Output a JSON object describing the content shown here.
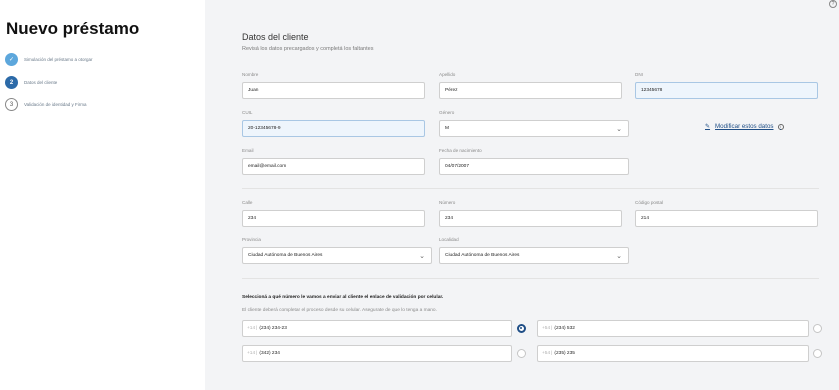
{
  "sidebar": {
    "title": "Nuevo préstamo",
    "steps": [
      {
        "label": "Simulación del préstamo a otorgar",
        "status": "done",
        "marker": "✓"
      },
      {
        "label": "Datos del cliente",
        "status": "active",
        "marker": "2"
      },
      {
        "label": "Validación de identidad y Firma",
        "status": "pending",
        "marker": "3"
      }
    ]
  },
  "form": {
    "title": "Datos del cliente",
    "subtitle": "Revisá los datos precargados y completá los faltantes",
    "fields": {
      "nombre": {
        "label": "Nombre",
        "value": "Juan"
      },
      "apellido": {
        "label": "Apellido",
        "value": "Pérez"
      },
      "dni": {
        "label": "DNI",
        "value": "12345678"
      },
      "cuil": {
        "label": "CUIL",
        "value": "20-12345678-9"
      },
      "genero": {
        "label": "Género",
        "value": "M"
      },
      "email": {
        "label": "Email",
        "value": "email@email.com"
      },
      "fecha": {
        "label": "Fecha de nacimiento",
        "value": "04/07/2007"
      },
      "calle": {
        "label": "Calle",
        "value": "234"
      },
      "numero": {
        "label": "Número",
        "value": "234"
      },
      "cp": {
        "label": "Código postal",
        "value": "214"
      },
      "provincia": {
        "label": "Provincia",
        "value": "Ciudad Autónoma de Buenos Aires"
      },
      "localidad": {
        "label": "Localidad",
        "value": "Ciudad Autónoma de Buenos Aires"
      }
    },
    "modify_link": "Modificar estos datos",
    "phone_section": {
      "heading": "Seleccioná a qué número le vamos a enviar al cliente el enlace de validación por celular.",
      "note": "El cliente deberá completar el proceso desde su celular. Asegurate de que lo tenga a mano.",
      "phones": [
        {
          "prefix": "+14",
          "number": "(234) 234-23",
          "selected": true
        },
        {
          "prefix": "+54",
          "number": "(234) 532",
          "selected": false
        },
        {
          "prefix": "+14",
          "number": "(342) 234",
          "selected": false
        },
        {
          "prefix": "+54",
          "number": "(235) 235",
          "selected": false
        }
      ]
    }
  },
  "icons": {
    "check": "check-icon",
    "pencil": "pencil-icon",
    "info": "info-icon",
    "chevron": "chevron-down-icon"
  },
  "colors": {
    "accent": "#1f4e86",
    "step_done": "#5da7dc",
    "step_active": "#2c6aa8",
    "prefilled_bg": "#eef5fc"
  }
}
